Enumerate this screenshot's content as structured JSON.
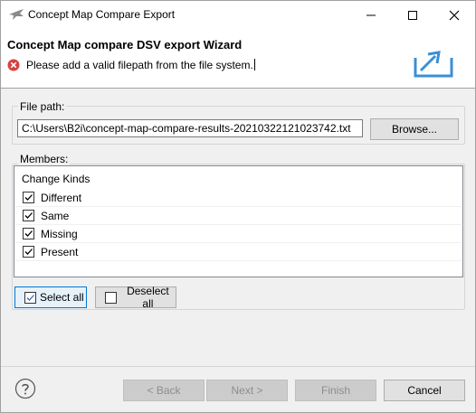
{
  "window": {
    "title": "Concept Map Compare Export"
  },
  "banner": {
    "title": "Concept Map compare DSV export Wizard",
    "error_message": "Please add a valid filepath from the file system."
  },
  "file_path": {
    "label": "File path:",
    "value": "C:\\Users\\B2i\\concept-map-compare-results-20210322121023742.txt",
    "browse_label": "Browse..."
  },
  "members": {
    "label": "Members:",
    "header": "Change Kinds",
    "items": [
      {
        "label": "Different",
        "checked": true
      },
      {
        "label": "Same",
        "checked": true
      },
      {
        "label": "Missing",
        "checked": true
      },
      {
        "label": "Present",
        "checked": true
      }
    ],
    "select_all_label": "Select all",
    "deselect_all_label": "Deselect all"
  },
  "footer": {
    "back_label": "< Back",
    "next_label": "Next >",
    "finish_label": "Finish",
    "cancel_label": "Cancel"
  },
  "icons": {
    "app": "arrow-logo-icon",
    "error": "error-icon",
    "banner": "export-icon",
    "help": "help-icon"
  },
  "colors": {
    "error_red": "#d94141",
    "banner_graphic": "#3b8fd6",
    "focus_blue": "#0078d7"
  }
}
